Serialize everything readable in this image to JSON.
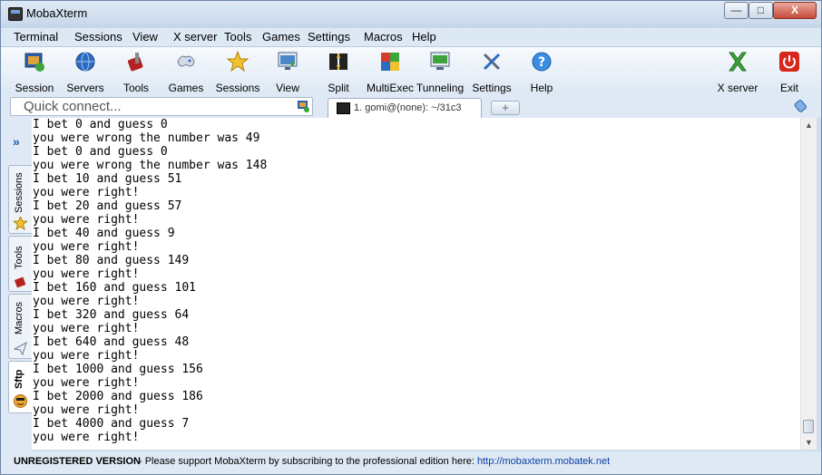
{
  "window": {
    "title": "MobaXterm",
    "minimize": "—",
    "maximize": "□",
    "close": "X"
  },
  "menu": [
    "Terminal",
    "Sessions",
    "View",
    "X server",
    "Tools",
    "Games",
    "Settings",
    "Macros",
    "Help"
  ],
  "toolbar": {
    "session": "Session",
    "servers": "Servers",
    "tools": "Tools",
    "games": "Games",
    "sessions": "Sessions",
    "view": "View",
    "split": "Split",
    "multiexec": "MultiExec",
    "tunneling": "Tunneling",
    "settings": "Settings",
    "help": "Help",
    "xserver": "X server",
    "exit": "Exit"
  },
  "quick_connect": {
    "placeholder": "Quick connect..."
  },
  "tabs": [
    {
      "label": "1. gomi@(none): ~/31c3"
    }
  ],
  "tab_add": "+",
  "side_tabs": {
    "sessions": "Sessions",
    "tools": "Tools",
    "macros": "Macros",
    "sftp": "Sftp"
  },
  "side_chevron": "»",
  "terminal": {
    "lines": [
      "I bet 0 and guess 0",
      "you were wrong the number was 49",
      "I bet 0 and guess 0",
      "you were wrong the number was 148",
      "I bet 10 and guess 51",
      "you were right!",
      "I bet 20 and guess 57",
      "you were right!",
      "I bet 40 and guess 9",
      "you were right!",
      "I bet 80 and guess 149",
      "you were right!",
      "I bet 160 and guess 101",
      "you were right!",
      "I bet 320 and guess 64",
      "you were right!",
      "I bet 640 and guess 48",
      "you were right!",
      "I bet 1000 and guess 156",
      "you were right!",
      "I bet 2000 and guess 186",
      "you were right!",
      "I bet 4000 and guess 7",
      "you were right!"
    ]
  },
  "scrollbar": {
    "up": "▲",
    "down": "▼"
  },
  "status": {
    "version": "UNREGISTERED VERSION",
    "message": " -  Please support MobaXterm by subscribing to the professional edition here:",
    "link": "http://mobaxterm.mobatek.net"
  }
}
